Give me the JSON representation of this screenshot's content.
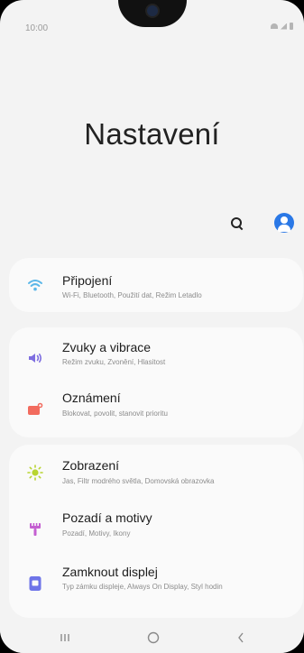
{
  "status": {
    "time": "10:00"
  },
  "header": {
    "title": "Nastavení"
  },
  "colors": {
    "accent": "#2a78e6",
    "wifi": "#5bb7e8",
    "sound": "#7e6ee0",
    "notifications": "#f26b5e",
    "display": "#b8d531",
    "wallpaper": "#c45fd1",
    "lock": "#6e74e8"
  },
  "groups": [
    {
      "items": [
        {
          "icon": "wifi-icon",
          "title": "Připojení",
          "subtitle": "Wi-Fi, Bluetooth, Použití dat, Režim Letadlo"
        }
      ]
    },
    {
      "items": [
        {
          "icon": "speaker-icon",
          "title": "Zvuky a vibrace",
          "subtitle": "Režim zvuku, Zvonění, Hlasitost"
        },
        {
          "icon": "notification-icon",
          "title": "Oznámení",
          "subtitle": "Blokovat, povolit, stanovit prioritu"
        }
      ]
    },
    {
      "items": [
        {
          "icon": "sun-icon",
          "title": "Zobrazení",
          "subtitle": "Jas, Filtr modrého světla, Domovská obrazovka"
        },
        {
          "icon": "brush-icon",
          "title": "Pozadí a motivy",
          "subtitle": "Pozadí, Motivy, Ikony"
        },
        {
          "icon": "lock-icon",
          "title": "Zamknout displej",
          "subtitle": "Typ zámku displeje, Always On Display, Styl hodin"
        }
      ]
    }
  ],
  "navigation": {
    "recents_icon": "recents-icon",
    "home_icon": "home-icon",
    "back_icon": "back-icon"
  }
}
